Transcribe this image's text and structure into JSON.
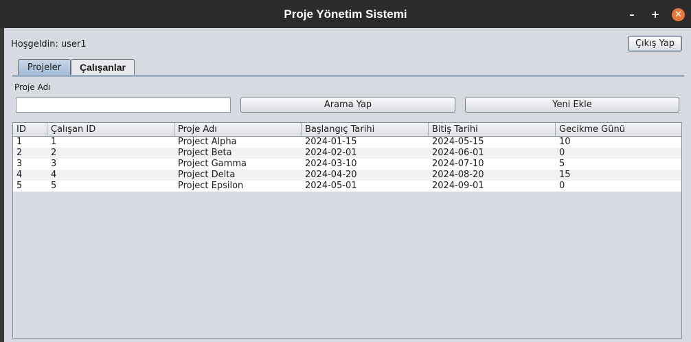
{
  "window": {
    "title": "Proje Yönetim Sistemi"
  },
  "header": {
    "welcome": "Hoşgeldin: user1",
    "logout_label": "Çıkış Yap"
  },
  "tabs": [
    {
      "label": "Projeler",
      "active": true
    },
    {
      "label": "Çalışanlar",
      "active": false
    }
  ],
  "form": {
    "name_label": "Proje Adı",
    "search_value": "",
    "search_label": "Arama Yap",
    "add_label": "Yeni Ekle"
  },
  "table": {
    "columns": [
      "ID",
      "Çalışan ID",
      "Proje Adı",
      "Başlangıç Tarihi",
      "Bitiş Tarihi",
      "Gecikme Günü"
    ],
    "rows": [
      [
        "1",
        "1",
        "Project Alpha",
        "2024-01-15",
        "2024-05-15",
        "10"
      ],
      [
        "2",
        "2",
        "Project Beta",
        "2024-02-01",
        "2024-06-01",
        "0"
      ],
      [
        "3",
        "3",
        "Project Gamma",
        "2024-03-10",
        "2024-07-10",
        "5"
      ],
      [
        "4",
        "4",
        "Project Delta",
        "2024-04-20",
        "2024-08-20",
        "15"
      ],
      [
        "5",
        "5",
        "Project Epsilon",
        "2024-05-01",
        "2024-09-01",
        "0"
      ]
    ]
  },
  "icons": {
    "minimize": "minimize-icon",
    "maximize": "maximize-icon",
    "close": "close-icon"
  },
  "colors": {
    "close_button": "#e8783a",
    "titlebar": "#2b2b2b",
    "active_tab": "#a3bbd6"
  }
}
